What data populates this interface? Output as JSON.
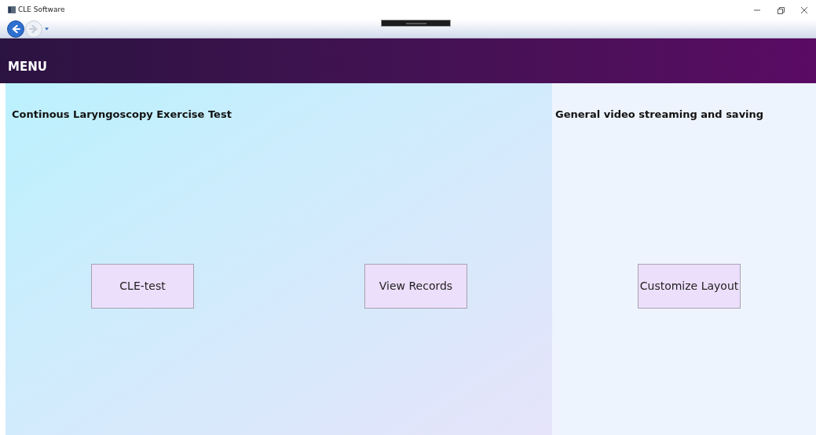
{
  "window": {
    "title": "CLE Software"
  },
  "navigation": [
    {
      "kind": "back",
      "disabled": false
    },
    {
      "kind": "forward",
      "disabled": true
    }
  ],
  "header": {
    "title": "MENU"
  },
  "panels": [
    {
      "title": "Continous Laryngoscopy Exercise Test",
      "buttons": [
        "CLE-test",
        "View Records"
      ]
    },
    {
      "title": "General video streaming and saving",
      "buttons": [
        "Customize Layout"
      ]
    }
  ]
}
